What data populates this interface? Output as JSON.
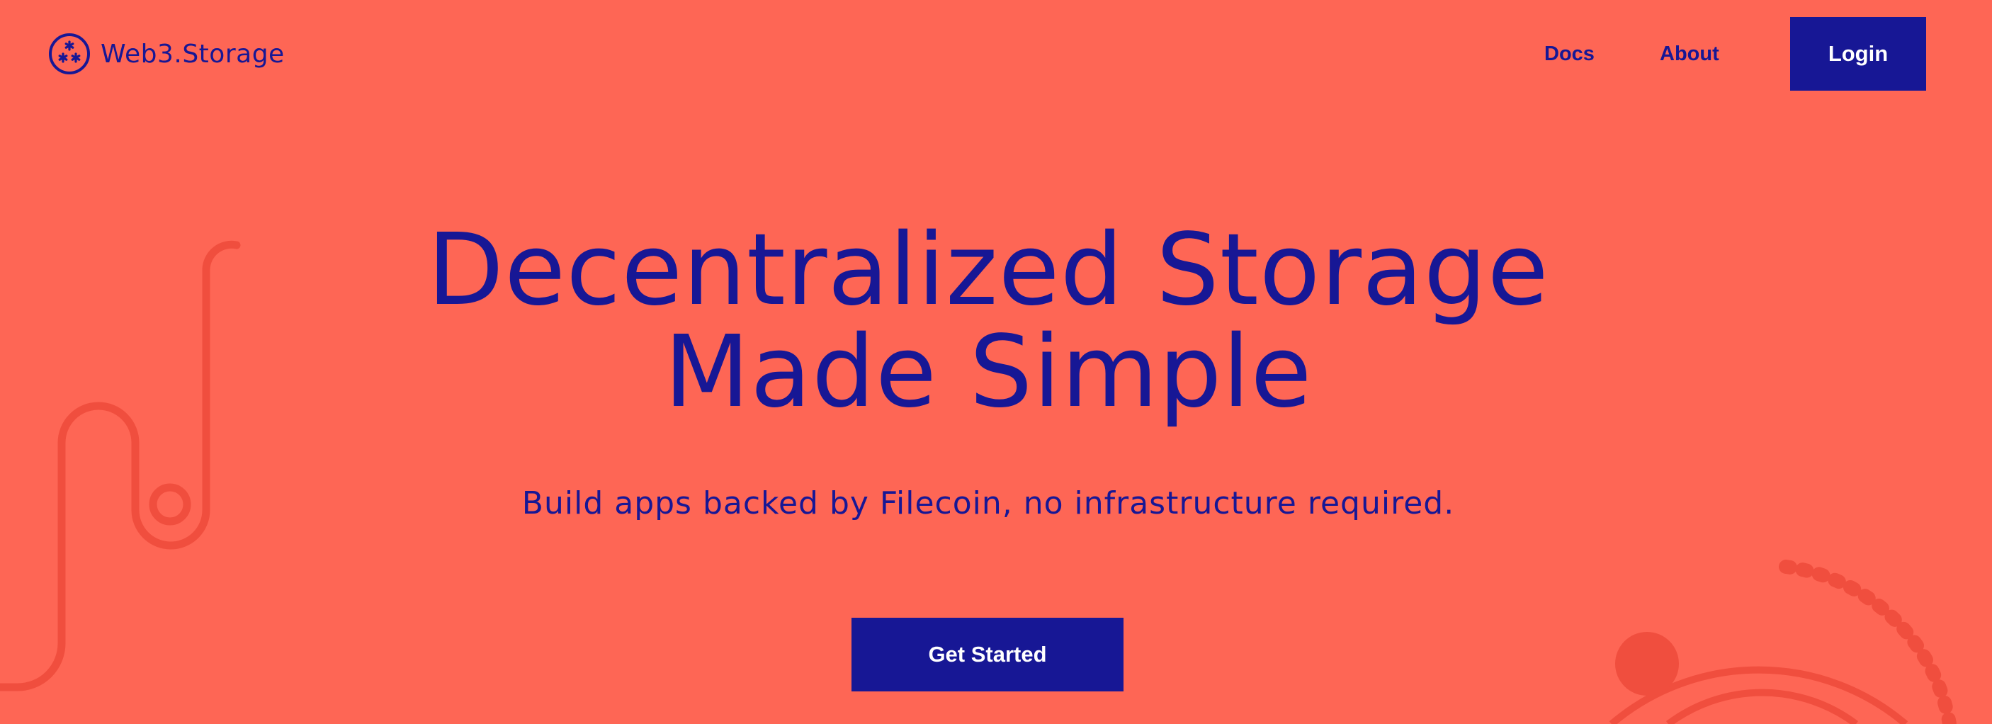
{
  "brand": {
    "name": "Web3.Storage",
    "icon": "web3-storage-logo-icon"
  },
  "nav": {
    "docs_label": "Docs",
    "about_label": "About",
    "login_label": "Login"
  },
  "hero": {
    "title_line1": "Decentralized Storage",
    "title_line2": "Made Simple",
    "subtitle": "Build apps backed by Filecoin, no infrastructure required.",
    "cta_label": "Get Started"
  },
  "colors": {
    "background": "#fe6655",
    "accent": "#171795",
    "decoration": "#f04e3e",
    "button_text": "#ffffff"
  }
}
